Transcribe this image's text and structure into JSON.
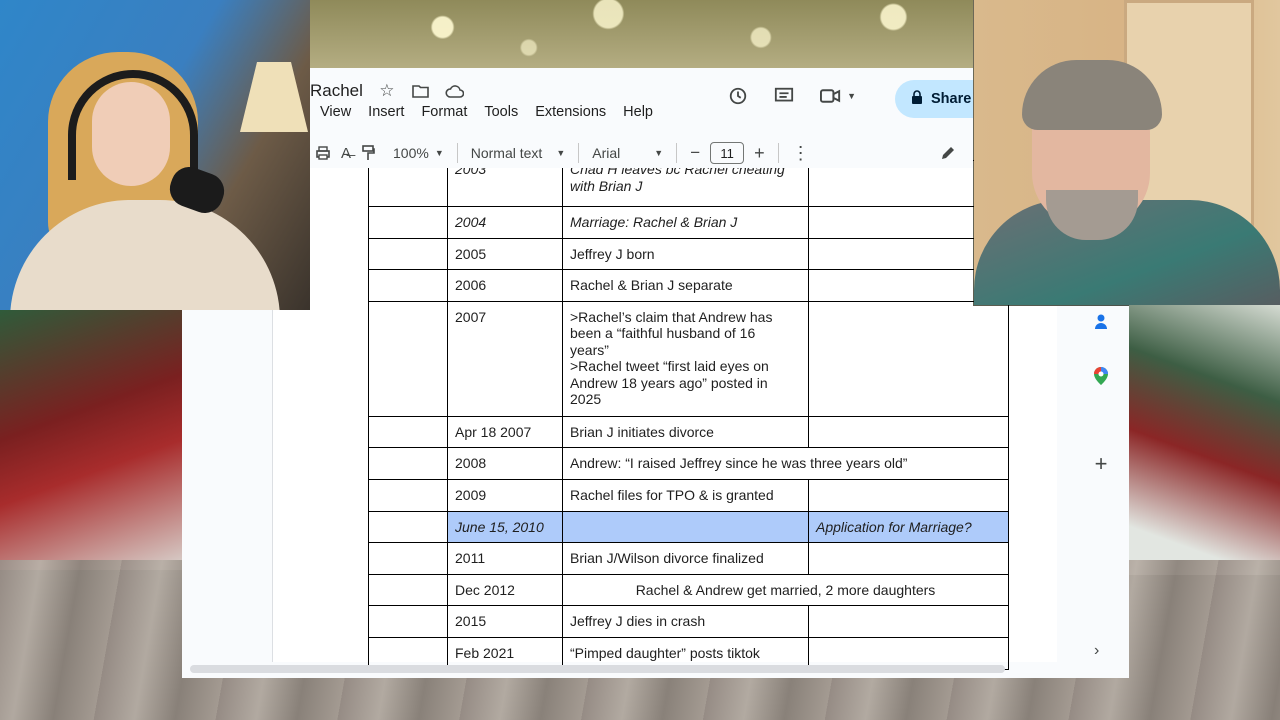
{
  "doc": {
    "title": "Rachel",
    "menu": [
      "View",
      "Insert",
      "Format",
      "Tools",
      "Extensions",
      "Help"
    ],
    "share_label": "Share",
    "toolbar": {
      "zoom": "100%",
      "style": "Normal text",
      "font": "Arial",
      "font_size": "11",
      "minus": "−",
      "plus": "+"
    },
    "table_rows": [
      {
        "year": "2003",
        "event": "Chad H leaves bc Rachel cheating\nwith Brian J",
        "note": "",
        "italic": true
      },
      {
        "year": "2004",
        "event": "Marriage: Rachel & Brian J",
        "note": "",
        "italic": true
      },
      {
        "year": "2005",
        "event": "Jeffrey J born",
        "note": ""
      },
      {
        "year": "2006",
        "event": "Rachel & Brian J separate",
        "note": ""
      },
      {
        "year": "2007",
        "event": ">Rachel’s claim that Andrew has\nbeen a “faithful husband of 16\nyears”\n>Rachel tweet “first laid eyes on\nAndrew 18 years ago” posted in\n2025",
        "note": ""
      },
      {
        "year": "Apr 18 2007",
        "event": "Brian J initiates divorce",
        "note": ""
      },
      {
        "year": "2008",
        "merged": "Andrew: “I raised Jeffrey since he was three years old”"
      },
      {
        "year": "2009",
        "event": "Rachel files for TPO & is granted",
        "note": ""
      },
      {
        "year": "June 15, 2010",
        "event": "",
        "note": "Application for Marriage?",
        "highlight": true
      },
      {
        "year": "2011",
        "event": "Brian J/Wilson divorce finalized",
        "note": ""
      },
      {
        "year": "Dec 2012",
        "merged_center": "Rachel & Andrew get married, 2 more daughters"
      },
      {
        "year": "2015",
        "event": "Jeffrey J dies in crash",
        "note": ""
      },
      {
        "year": "Feb 2021",
        "event": "“Pimped daughter” posts tiktok",
        "note": ""
      }
    ]
  },
  "colors": {
    "share_bg": "#c2e7ff",
    "highlight": "#aecbfa",
    "docs_bg": "#f9fbfd"
  }
}
